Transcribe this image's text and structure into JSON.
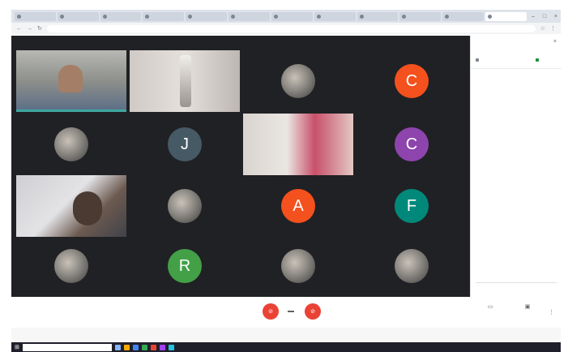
{
  "browser": {
    "tabs": [
      "",
      "",
      "",
      "",
      "",
      "",
      "",
      "",
      "",
      "",
      "",
      ""
    ],
    "active_tab_index": 11,
    "url": ""
  },
  "participants": [
    {
      "type": "video",
      "name": ""
    },
    {
      "type": "video",
      "name": ""
    },
    {
      "type": "photo"
    },
    {
      "type": "initial",
      "initial": "C",
      "color": "#f4511e"
    },
    {
      "type": "photo"
    },
    {
      "type": "initial",
      "initial": "J",
      "color": "#455a64"
    },
    {
      "type": "video",
      "name": ""
    },
    {
      "type": "initial",
      "initial": "C",
      "color": "#8e44ad"
    },
    {
      "type": "video",
      "name": ""
    },
    {
      "type": "photo"
    },
    {
      "type": "initial",
      "initial": "A",
      "color": "#f4511e"
    },
    {
      "type": "initial",
      "initial": "F",
      "color": "#00897b"
    },
    {
      "type": "photo"
    },
    {
      "type": "initial",
      "initial": "R",
      "color": "#43a047"
    },
    {
      "type": "photo"
    },
    {
      "type": "photo"
    }
  ],
  "side_panel": {
    "title": "",
    "tab_everyone": "",
    "tab_chat": "",
    "message": "",
    "input_placeholder": ""
  },
  "controls": {
    "meeting_details": "",
    "mic_icon": "mic-off-icon",
    "camera_icon": "camera-off-icon",
    "captions": "",
    "present": ""
  },
  "status_strip": {
    "left": "",
    "right": ""
  },
  "taskbar": {
    "search_placeholder": "",
    "clock": ""
  },
  "colors": {
    "meeting_bg": "#202124",
    "danger": "#ea4335",
    "chat_green": "#1e8e3e"
  }
}
